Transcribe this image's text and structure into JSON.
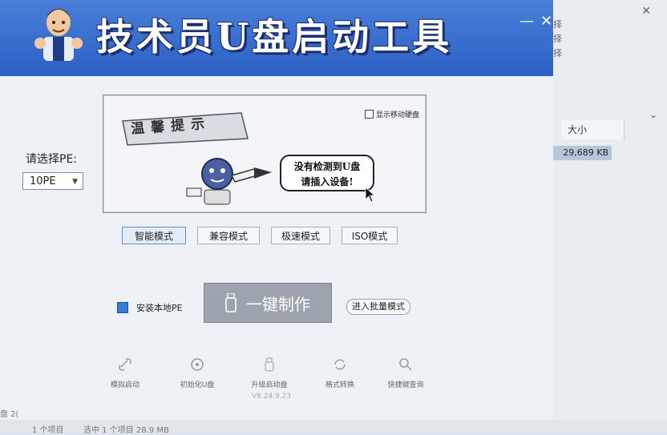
{
  "app": {
    "title": "技术员U盘启动工具",
    "window_controls": {
      "minimize": "—",
      "close": "✕"
    }
  },
  "notice": {
    "stamp_text": "温馨提示",
    "checkbox_label": "显示移动硬盘",
    "message_line1": "没有检测到U盘",
    "message_line2": "请插入设备!"
  },
  "pe": {
    "label": "请选择PE:",
    "selected": "10PE"
  },
  "modes": [
    "智能模式",
    "兼容模式",
    "极速模式",
    "ISO模式"
  ],
  "actions": {
    "install_local": "安装本地PE",
    "make_button": "一键制作",
    "batch_mode": "进入批量模式"
  },
  "tools": [
    "模拟启动",
    "初始化U盘",
    "升级启动盘",
    "格式转换",
    "快捷键查询"
  ],
  "version": "V8.24.9.23",
  "background": {
    "column_header": "大小",
    "file_size": "29,689 KB",
    "status_items": "1 个项目",
    "status_selected": "选中 1 个项目 28.9 MB",
    "side_text": "择 择 择",
    "lower_left": "盘 2("
  },
  "colors": {
    "banner": "#2c5fc4",
    "make_button": "#9ea4ad"
  }
}
